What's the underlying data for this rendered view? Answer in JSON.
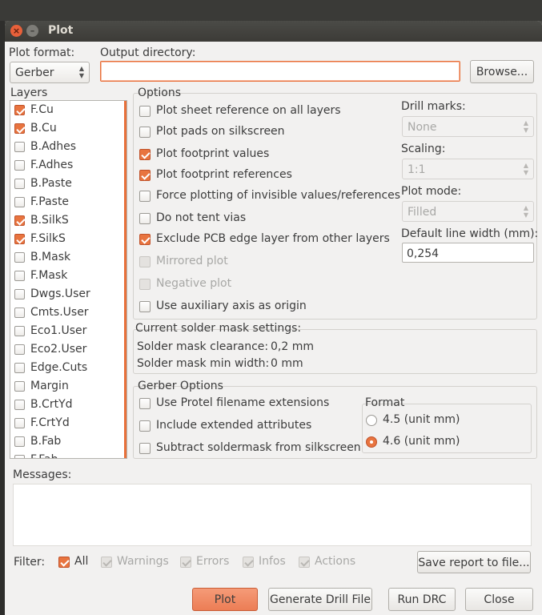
{
  "window": {
    "title": "Plot"
  },
  "plot_format": {
    "label": "Plot format:",
    "value": "Gerber"
  },
  "output_directory": {
    "label": "Output directory:",
    "value": "",
    "browse_label": "Browse..."
  },
  "layers": {
    "label": "Layers",
    "items": [
      {
        "name": "F.Cu",
        "checked": true
      },
      {
        "name": "B.Cu",
        "checked": true
      },
      {
        "name": "B.Adhes",
        "checked": false
      },
      {
        "name": "F.Adhes",
        "checked": false
      },
      {
        "name": "B.Paste",
        "checked": false
      },
      {
        "name": "F.Paste",
        "checked": false
      },
      {
        "name": "B.SilkS",
        "checked": true
      },
      {
        "name": "F.SilkS",
        "checked": true
      },
      {
        "name": "B.Mask",
        "checked": false
      },
      {
        "name": "F.Mask",
        "checked": false
      },
      {
        "name": "Dwgs.User",
        "checked": false
      },
      {
        "name": "Cmts.User",
        "checked": false
      },
      {
        "name": "Eco1.User",
        "checked": false
      },
      {
        "name": "Eco2.User",
        "checked": false
      },
      {
        "name": "Edge.Cuts",
        "checked": false
      },
      {
        "name": "Margin",
        "checked": false
      },
      {
        "name": "B.CrtYd",
        "checked": false
      },
      {
        "name": "F.CrtYd",
        "checked": false
      },
      {
        "name": "B.Fab",
        "checked": false
      },
      {
        "name": "F.Fab",
        "checked": false
      }
    ]
  },
  "options": {
    "label": "Options",
    "items": [
      {
        "label": "Plot sheet reference on all layers",
        "checked": false,
        "disabled": false
      },
      {
        "label": "Plot pads on silkscreen",
        "checked": false,
        "disabled": false
      },
      {
        "label": "Plot footprint values",
        "checked": true,
        "disabled": false
      },
      {
        "label": "Plot footprint references",
        "checked": true,
        "disabled": false
      },
      {
        "label": "Force plotting of invisible values/references",
        "checked": false,
        "disabled": false
      },
      {
        "label": "Do not tent vias",
        "checked": false,
        "disabled": false
      },
      {
        "label": "Exclude PCB edge layer from other layers",
        "checked": true,
        "disabled": false
      },
      {
        "label": "Mirrored plot",
        "checked": false,
        "disabled": true
      },
      {
        "label": "Negative plot",
        "checked": false,
        "disabled": true
      },
      {
        "label": "Use auxiliary axis as origin",
        "checked": false,
        "disabled": false
      }
    ],
    "drill_marks": {
      "label": "Drill marks:",
      "value": "None"
    },
    "scaling": {
      "label": "Scaling:",
      "value": "1:1"
    },
    "plot_mode": {
      "label": "Plot mode:",
      "value": "Filled"
    },
    "line_width": {
      "label": "Default line width (mm):",
      "value": "0,254"
    }
  },
  "solder_mask": {
    "label": "Current solder mask settings:",
    "clearance_label": "Solder mask clearance:",
    "clearance_value": "0,2 mm",
    "min_width_label": "Solder mask min width:",
    "min_width_value": "0 mm"
  },
  "gerber": {
    "label": "Gerber Options",
    "items": [
      {
        "label": "Use Protel filename extensions",
        "checked": false
      },
      {
        "label": "Include extended attributes",
        "checked": false
      },
      {
        "label": "Subtract soldermask from silkscreen",
        "checked": false
      }
    ],
    "format": {
      "label": "Format",
      "options": [
        {
          "label": "4.5 (unit mm)",
          "selected": false
        },
        {
          "label": "4.6 (unit mm)",
          "selected": true
        }
      ]
    }
  },
  "messages": {
    "label": "Messages:",
    "filter_label": "Filter:",
    "filters": [
      {
        "label": "All",
        "checked": true,
        "disabled": false
      },
      {
        "label": "Warnings",
        "checked": true,
        "disabled": true
      },
      {
        "label": "Errors",
        "checked": true,
        "disabled": true
      },
      {
        "label": "Infos",
        "checked": true,
        "disabled": true
      },
      {
        "label": "Actions",
        "checked": true,
        "disabled": true
      }
    ],
    "save_report_label": "Save report to file..."
  },
  "buttons": {
    "plot": "Plot",
    "generate_drill": "Generate Drill File",
    "run_drc": "Run DRC",
    "close": "Close"
  },
  "colors": {
    "accent": "#e8743f",
    "titlebar": "#3c3b37"
  }
}
